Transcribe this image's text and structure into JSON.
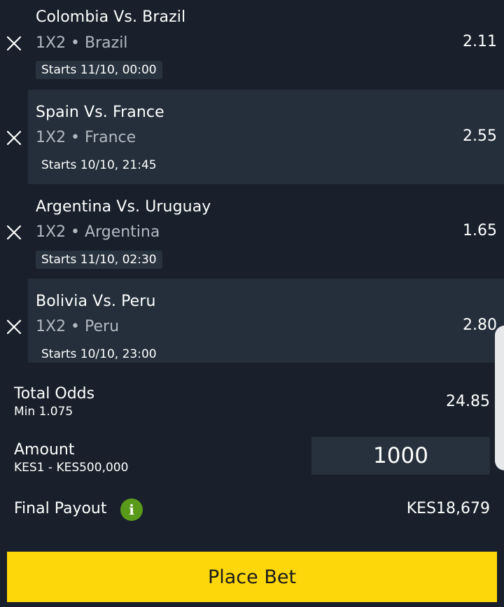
{
  "bets": [
    {
      "match": "Colombia Vs. Brazil",
      "market": "1X2 • Brazil",
      "starts": "Starts 11/10, 00:00",
      "odds": "2.11"
    },
    {
      "match": "Spain Vs. France",
      "market": "1X2 • France",
      "starts": "Starts 10/10, 21:45",
      "odds": "2.55"
    },
    {
      "match": "Argentina Vs. Uruguay",
      "market": "1X2 • Argentina",
      "starts": "Starts 11/10, 02:30",
      "odds": "1.65"
    },
    {
      "match": "Bolivia Vs. Peru",
      "market": "1X2 • Peru",
      "starts": "Starts 10/10, 23:00",
      "odds": "2.80"
    }
  ],
  "summary": {
    "total_odds_label": "Total Odds",
    "total_odds_min": "Min 1.075",
    "total_odds_value": "24.85",
    "amount_label": "Amount",
    "amount_range": "KES1 - KES500,000",
    "amount_value": "1000",
    "payout_label": "Final Payout",
    "payout_value": "KES18,679",
    "info_icon": "i"
  },
  "actions": {
    "place_bet": "Place Bet"
  },
  "icons": {
    "remove": "close-icon",
    "info": "info-icon"
  },
  "colors": {
    "background": "#19202b",
    "alt_row": "#242f3b",
    "accent": "#fdd709",
    "info": "#5a9a1b"
  }
}
